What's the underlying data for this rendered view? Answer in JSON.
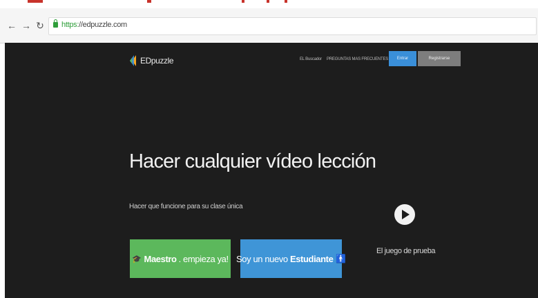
{
  "browser": {
    "back_icon": "back-arrow-icon",
    "forward_icon": "forward-arrow-icon",
    "reload_icon": "reload-icon",
    "url_scheme": "https:",
    "url_rest": "//edpuzzle.com",
    "secure_color": "#2f9e3a"
  },
  "header": {
    "logo_text": "EDpuzzle",
    "nav_links": [
      "EL Buscador",
      "PREGUNTAS MAS FRECUENTES"
    ],
    "login_label": "Entrar",
    "signup_label": "Registrarse"
  },
  "hero": {
    "title": "Hacer cualquier vídeo lección",
    "subtitle": "Hacer que funcione para su clase única",
    "teacher_cta_bold": "Maestro",
    "teacher_cta_rest": ". empieza ya!",
    "student_cta_prefix": "Soy un nuevo ",
    "student_cta_bold": "Estudiante",
    "demo_label": "El juego de prueba"
  },
  "colors": {
    "page_bg": "#1d1d1d",
    "teacher_green": "#5cb85c",
    "student_blue": "#3f95d7",
    "login_blue": "#3a8fd9",
    "signup_gray": "#7d7d7d"
  }
}
